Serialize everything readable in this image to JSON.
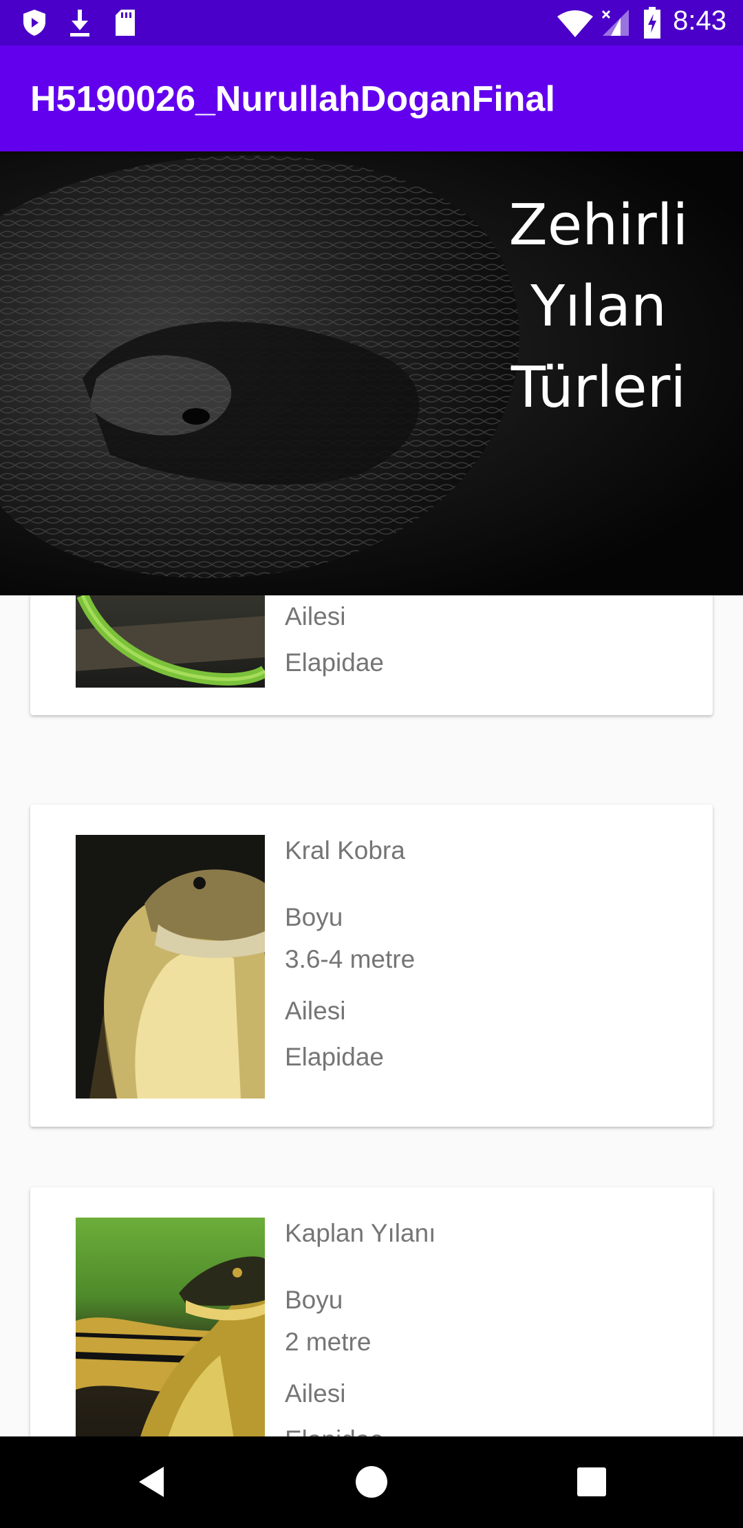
{
  "status_bar": {
    "time": "8:43",
    "left_icons": [
      "shield-icon",
      "download-icon",
      "sd-card-icon"
    ],
    "right_icons": [
      "wifi-icon",
      "signal-icon",
      "battery-icon"
    ]
  },
  "app_bar": {
    "title": "H5190026_NurullahDoganFinal"
  },
  "banner": {
    "lines": [
      "Zehirli",
      "Yılan",
      "Türleri"
    ]
  },
  "cards": [
    {
      "name": "",
      "boyu_label": "",
      "boyu_value": "",
      "ailesi_label": "Ailesi",
      "ailesi_value": "Elapidae",
      "image": "green-snake-image"
    },
    {
      "name": "Kral Kobra",
      "boyu_label": "Boyu",
      "boyu_value": "3.6-4 metre",
      "ailesi_label": "Ailesi",
      "ailesi_value": "Elapidae",
      "image": "king-cobra-image"
    },
    {
      "name": "Kaplan Yılanı",
      "boyu_label": "Boyu",
      "boyu_value": "2 metre",
      "ailesi_label": "Ailesi",
      "ailesi_value": "Elapidae",
      "image": "tiger-snake-image"
    }
  ],
  "nav_bar": {
    "buttons": [
      "back-icon",
      "home-icon",
      "recents-icon"
    ]
  },
  "colors": {
    "status_bar": "#4a00c8",
    "app_bar": "#6200ee",
    "text_secondary": "#757575"
  }
}
